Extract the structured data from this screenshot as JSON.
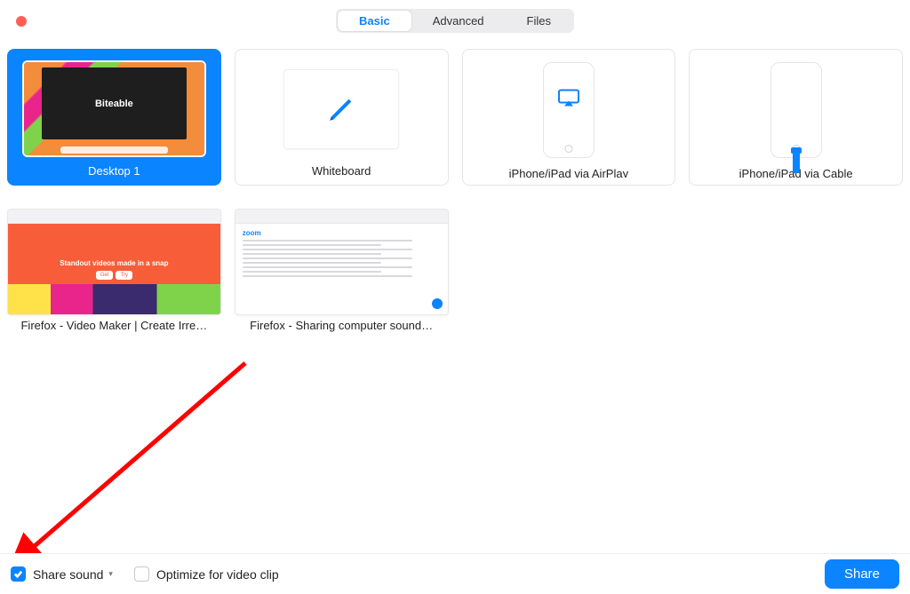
{
  "window": {
    "close_color": "#ff5f57"
  },
  "tabs": {
    "items": [
      {
        "label": "Basic",
        "active": true
      },
      {
        "label": "Advanced",
        "active": false
      },
      {
        "label": "Files",
        "active": false
      }
    ]
  },
  "tiles": {
    "desktop": {
      "label": "Desktop 1",
      "thumb_text": "Biteable"
    },
    "whiteboard": {
      "label": "Whiteboard"
    },
    "airplay": {
      "label": "iPhone/iPad via AirPlay"
    },
    "cable": {
      "label": "iPhone/iPad via Cable"
    },
    "firefox_biteable": {
      "label": "Firefox - Video Maker | Create Irre…",
      "hero_text": "Standout videos made in a snap"
    },
    "firefox_zoom": {
      "label": "Firefox - Sharing computer sound…",
      "page_brand": "zoom"
    }
  },
  "footer": {
    "share_sound": {
      "label": "Share sound",
      "checked": true,
      "has_menu": true
    },
    "optimize": {
      "label": "Optimize for video clip",
      "checked": false
    },
    "share_button": "Share"
  },
  "colors": {
    "accent": "#0b84ff",
    "annotation": "#ff0000"
  }
}
